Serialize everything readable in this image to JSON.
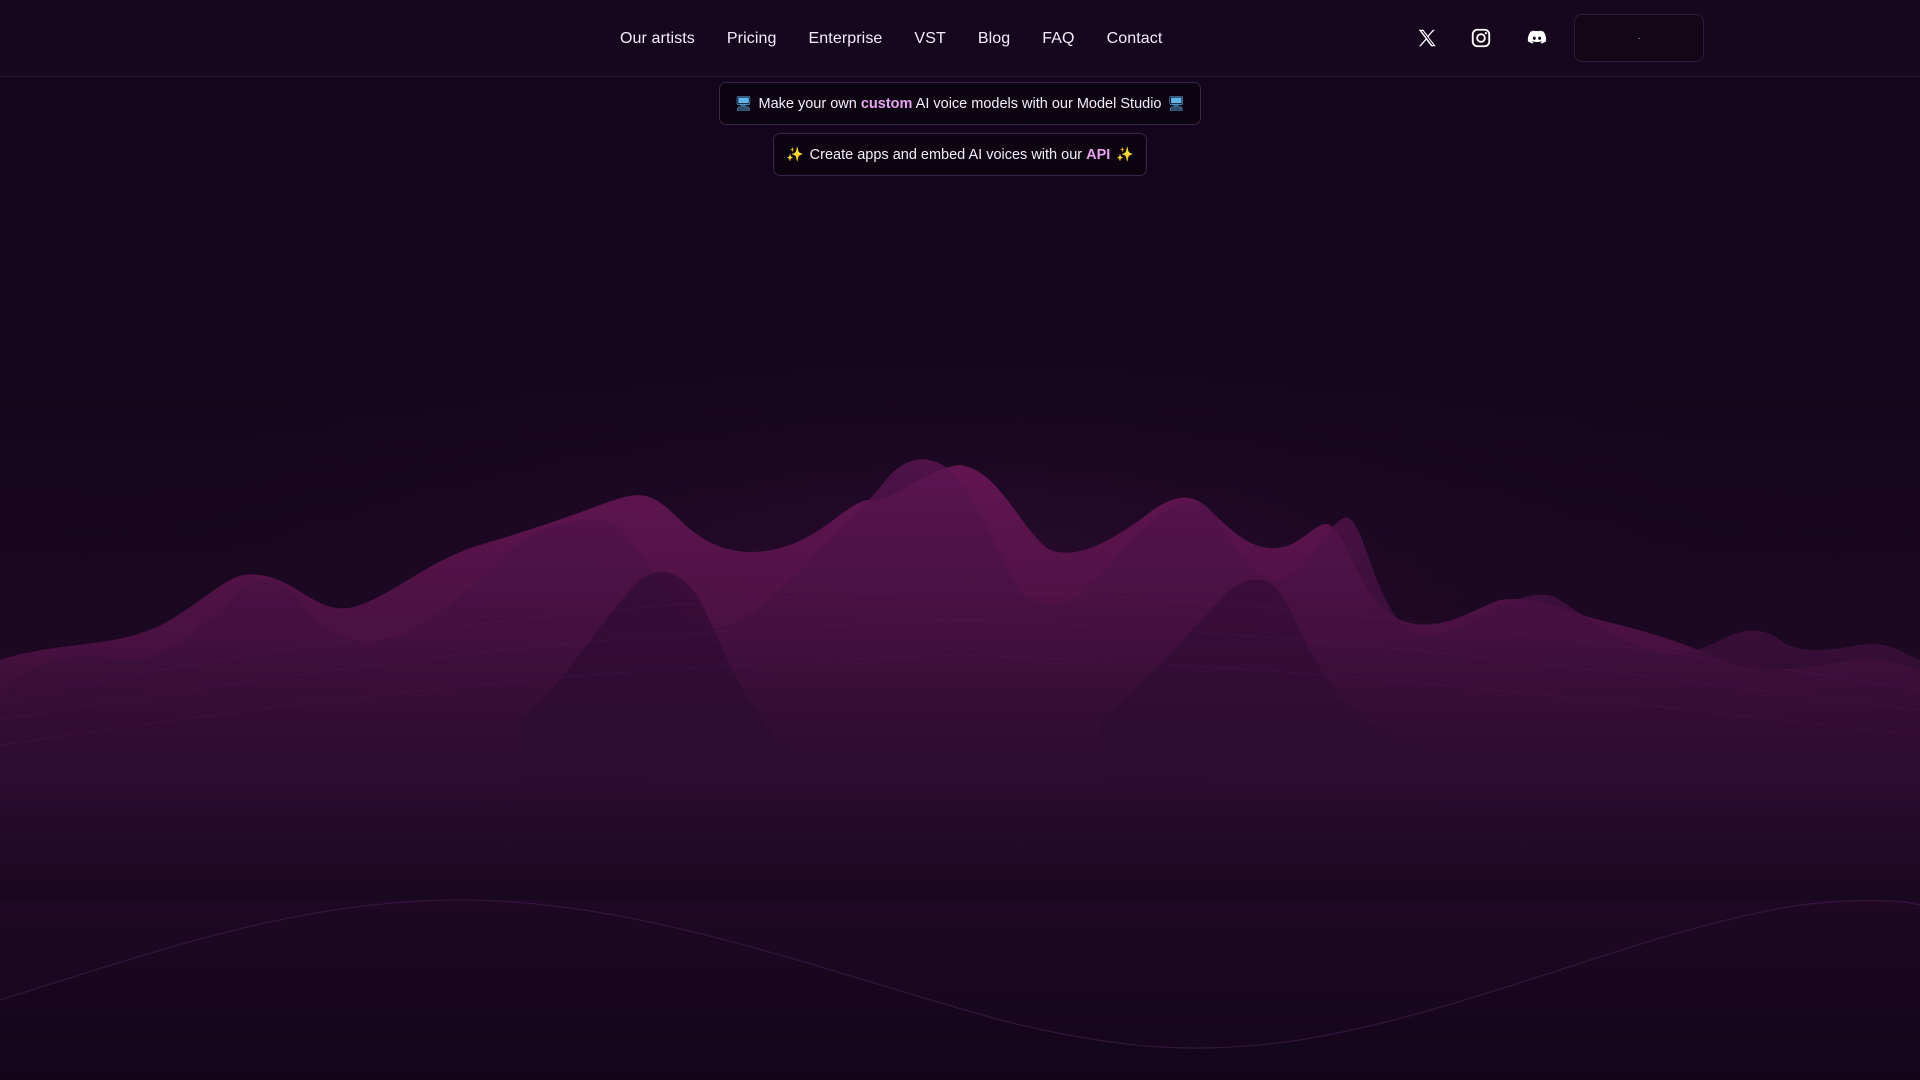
{
  "nav": {
    "links": [
      {
        "label": "Our artists"
      },
      {
        "label": "Pricing"
      },
      {
        "label": "Enterprise"
      },
      {
        "label": "VST"
      },
      {
        "label": "Blog"
      },
      {
        "label": "FAQ"
      },
      {
        "label": "Contact"
      }
    ],
    "social": [
      "x-icon",
      "instagram-icon",
      "discord-icon"
    ],
    "cta_label": "·"
  },
  "banners": [
    {
      "icon": "monitor-icon",
      "prefix": "Make your own ",
      "highlight": "custom",
      "suffix": " AI voice models with our Model Studio"
    },
    {
      "icon": "sparkles-icon",
      "prefix": "Create apps and embed AI voices with our ",
      "highlight": "API",
      "suffix": ""
    }
  ],
  "colors": {
    "background": "#12061c",
    "highlight": "#e9a4f0",
    "wave": "#7a1a5e"
  }
}
